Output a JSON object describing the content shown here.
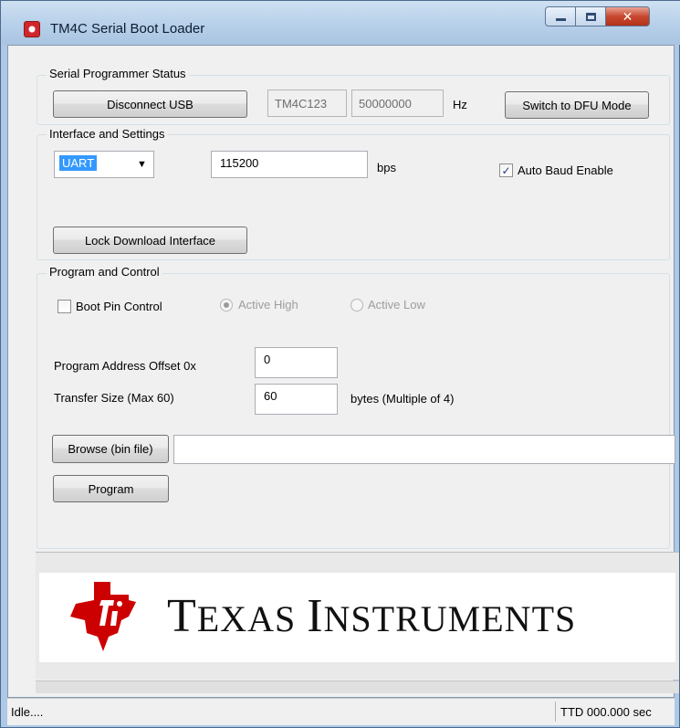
{
  "window": {
    "title": "TM4C Serial Boot Loader"
  },
  "programmer_status": {
    "group_label": "Serial Programmer Status",
    "disconnect_label": "Disconnect USB",
    "device": "TM4C123",
    "frequency": "50000000",
    "frequency_unit": "Hz",
    "dfu_label": "Switch to DFU Mode"
  },
  "interface": {
    "group_label": "Interface and Settings",
    "selected_interface": "UART",
    "baud_rate": "115200",
    "baud_unit": "bps",
    "auto_baud_label": "Auto Baud Enable",
    "auto_baud_checked": true,
    "lock_label": "Lock Download Interface"
  },
  "program_control": {
    "group_label": "Program and Control",
    "boot_pin_label": "Boot Pin Control",
    "boot_pin_checked": false,
    "active_high_label": "Active High",
    "active_low_label": "Active Low",
    "address_offset_label": "Program Address Offset 0x",
    "address_offset_value": "0",
    "transfer_size_label": "Transfer Size (Max 60)",
    "transfer_size_value": "60",
    "transfer_size_unit": "bytes (Multiple of 4)",
    "browse_label": "Browse (bin file)",
    "file_path": "",
    "program_label": "Program"
  },
  "logo": {
    "brand_text": "Texas Instruments",
    "brand_color": "#cc0000"
  },
  "statusbar": {
    "status": "Idle....",
    "ttd": "TTD 000.000 sec"
  },
  "icons": [
    "app-icon",
    "minimize-icon",
    "maximize-icon",
    "close-icon",
    "dropdown-arrow-icon",
    "checkmark-icon",
    "ti-logo-icon"
  ]
}
